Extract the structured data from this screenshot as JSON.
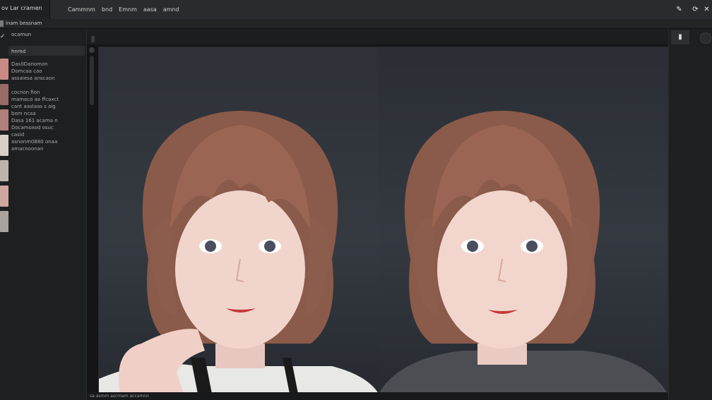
{
  "top_bar": {
    "app_tab_label": "ov Lar cramen",
    "menu_items": [
      "Cammnm",
      "bnd",
      "Emnm",
      "aasa",
      "amnd"
    ],
    "icons": [
      "pen-icon",
      "refresh-icon",
      "close-icon"
    ]
  },
  "sub_bar": {
    "tab_label": "lnam bessnam"
  },
  "sidebar": {
    "title": "ocamun",
    "strip_label": "hnmd",
    "lines": [
      "Das0Danomon",
      "Domcaa cao",
      "assaiesa anscaon",
      "",
      "cocnon fion",
      "mamaco aa ffcaxct",
      "cant aaslaas s aig",
      "bom ncaa",
      "Dasa 161 acama n",
      "Docamoxod osuc",
      "casid",
      "asnonm0880 onaa",
      "amacnoonan"
    ],
    "thumb_colors": [
      "#c98a86",
      "#9a6b66",
      "#b37f7a",
      "#d8cfc9",
      "#bdb4ae",
      "#cfa7a0",
      "#a9a3a0"
    ]
  },
  "canvas": {
    "status_text": "sa asmm ascmam accamnn",
    "left_image_label": "",
    "right_image_label": ""
  },
  "right_panel": {
    "button_icon": "book-icon"
  }
}
